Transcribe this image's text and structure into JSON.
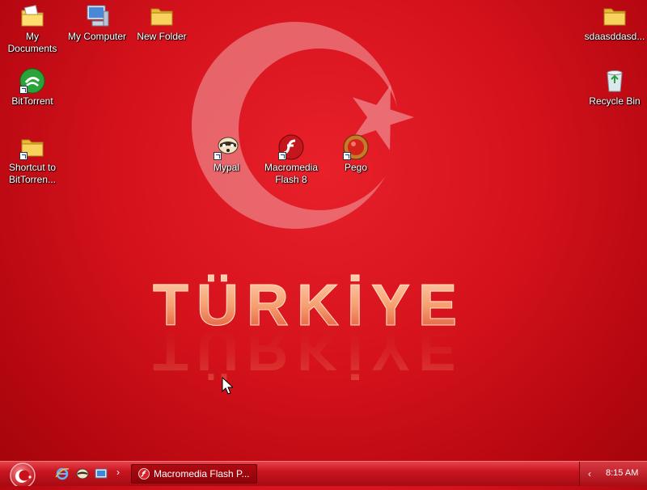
{
  "desktop_icons": {
    "my_documents": "My\nDocuments",
    "my_computer": "My Computer",
    "new_folder": "New Folder",
    "sdaas": "sdaasddasd...",
    "bittorrent": "BitTorrent",
    "recycle_bin": "Recycle Bin",
    "shortcut_bittorrent": "Shortcut to\nBitTorren...",
    "mypal": "Mypal",
    "flash8": "Macromedia\nFlash 8",
    "pego": "Pego"
  },
  "wallpaper": {
    "word": "TÜRKİYE",
    "background_color": "#d5121c",
    "emblem": "crescent-and-star"
  },
  "taskbar": {
    "task_label": "Macromedia Flash P...",
    "clock": "8:15 AM",
    "quick_launch": [
      "internet-explorer-icon",
      "mypal-icon",
      "show-desktop-icon"
    ],
    "chevron": "›",
    "tray_chevron": "‹"
  }
}
